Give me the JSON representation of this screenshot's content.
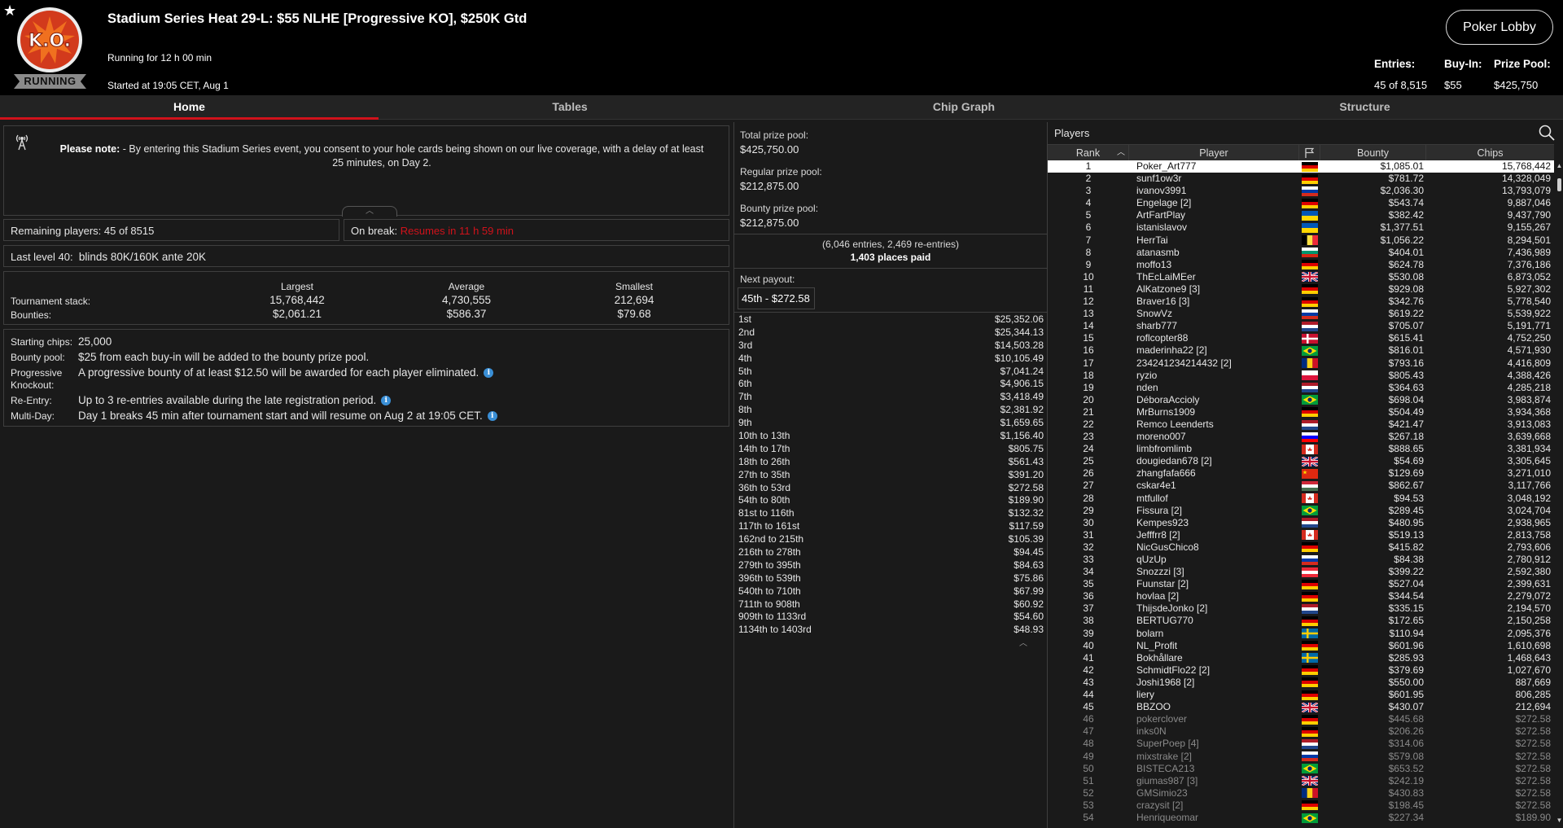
{
  "header": {
    "title": "Stadium Series Heat 29-L: $55 NLHE [Progressive KO], $250K Gtd",
    "logo_text": "K.O.",
    "status": "RUNNING",
    "running_for": "Running for 12 h 00 min",
    "started_at": "Started at 19:05 CET, Aug 1",
    "lobby_button": "Poker Lobby",
    "entries_label": "Entries:",
    "entries_value": "45 of 8,515",
    "buyin_label": "Buy-In:",
    "buyin_value": "$55",
    "prize_label": "Prize Pool:",
    "prize_value": "$425,750"
  },
  "tabs": [
    {
      "label": "Home",
      "active": true
    },
    {
      "label": "Tables",
      "active": false
    },
    {
      "label": "Chip Graph",
      "active": false
    },
    {
      "label": "Structure",
      "active": false
    }
  ],
  "notice": {
    "bold": "Please note:",
    "text": " - By entering this Stadium Series event, you consent to your hole cards being shown on our live coverage, with a delay of at least 25 minutes, on Day 2."
  },
  "remaining": {
    "label": "Remaining players:",
    "value": "45 of 8515"
  },
  "on_break": {
    "label": "On break:",
    "value": "Resumes in 11 h 59 min"
  },
  "last_level": {
    "label": "Last level 40:",
    "value": "blinds 80K/160K ante 20K"
  },
  "stacks": {
    "headers": [
      "Largest",
      "Average",
      "Smallest"
    ],
    "rows": [
      {
        "label": "Tournament stack:",
        "values": [
          "15,768,442",
          "4,730,555",
          "212,694"
        ]
      },
      {
        "label": "Bounties:",
        "values": [
          "$2,061.21",
          "$586.37",
          "$79.68"
        ]
      }
    ]
  },
  "details": {
    "starting_chips": {
      "label": "Starting chips:",
      "value": "25,000"
    },
    "bounty_pool": {
      "label": "Bounty pool:",
      "value": "$25 from each buy-in will be added to the bounty prize pool."
    },
    "progressive": {
      "label1": "Progressive",
      "label2": "Knockout:",
      "value": "A progressive bounty of at least $12.50 will be awarded for each player eliminated."
    },
    "reentry": {
      "label": "Re-Entry:",
      "value": "Up to 3 re-entries available during the late registration period."
    },
    "multiday": {
      "label": "Multi-Day:",
      "value": "Day 1 breaks 45 min after tournament start and will resume on Aug 2 at 19:05 CET."
    },
    "info_glyph": "i"
  },
  "prize_pools": {
    "total_label": "Total prize pool:",
    "total_value": "$425,750.00",
    "regular_label": "Regular prize pool:",
    "regular_value": "$212,875.00",
    "bounty_label": "Bounty prize pool:",
    "bounty_value": "$212,875.00",
    "entries_note": "(6,046 entries, 2,469 re-entries)",
    "places_paid": "1,403 places paid",
    "next_payout_label": "Next payout:",
    "next_payout_value": "45th - $272.58"
  },
  "payouts": [
    {
      "place": "1st",
      "amount": "$25,352.06"
    },
    {
      "place": "2nd",
      "amount": "$25,344.13"
    },
    {
      "place": "3rd",
      "amount": "$14,503.28"
    },
    {
      "place": "4th",
      "amount": "$10,105.49"
    },
    {
      "place": "5th",
      "amount": "$7,041.24"
    },
    {
      "place": "6th",
      "amount": "$4,906.15"
    },
    {
      "place": "7th",
      "amount": "$3,418.49"
    },
    {
      "place": "8th",
      "amount": "$2,381.92"
    },
    {
      "place": "9th",
      "amount": "$1,659.65"
    },
    {
      "place": "10th to 13th",
      "amount": "$1,156.40"
    },
    {
      "place": "14th to 17th",
      "amount": "$805.75"
    },
    {
      "place": "18th to 26th",
      "amount": "$561.43"
    },
    {
      "place": "27th to 35th",
      "amount": "$391.20"
    },
    {
      "place": "36th to 53rd",
      "amount": "$272.58"
    },
    {
      "place": "54th to 80th",
      "amount": "$189.90"
    },
    {
      "place": "81st to 116th",
      "amount": "$132.32"
    },
    {
      "place": "117th to 161st",
      "amount": "$117.59"
    },
    {
      "place": "162nd to 215th",
      "amount": "$105.39"
    },
    {
      "place": "216th to 278th",
      "amount": "$94.45"
    },
    {
      "place": "279th to 395th",
      "amount": "$84.63"
    },
    {
      "place": "396th to 539th",
      "amount": "$75.86"
    },
    {
      "place": "540th to 710th",
      "amount": "$67.99"
    },
    {
      "place": "711th to 908th",
      "amount": "$60.92"
    },
    {
      "place": "909th to 1133rd",
      "amount": "$54.60"
    },
    {
      "place": "1134th to 1403rd",
      "amount": "$48.93"
    }
  ],
  "players": {
    "title": "Players",
    "columns": {
      "rank": "Rank",
      "player": "Player",
      "bounty": "Bounty",
      "chips": "Chips"
    },
    "rows": [
      {
        "rank": "1",
        "name": "Poker_Art777",
        "flag": "de",
        "bounty": "$1,085.01",
        "chips": "15,768,442"
      },
      {
        "rank": "2",
        "name": "sunf1ow3r",
        "flag": "de",
        "bounty": "$781.72",
        "chips": "14,328,049"
      },
      {
        "rank": "3",
        "name": "ivanov3991",
        "flag": "ru",
        "bounty": "$2,036.30",
        "chips": "13,793,079"
      },
      {
        "rank": "4",
        "name": "Engelage [2]",
        "flag": "de",
        "bounty": "$543.74",
        "chips": "9,887,046"
      },
      {
        "rank": "5",
        "name": "ArtFartPlay",
        "flag": "ua",
        "bounty": "$382.42",
        "chips": "9,437,790"
      },
      {
        "rank": "6",
        "name": "istanislavov",
        "flag": "ua",
        "bounty": "$1,377.51",
        "chips": "9,155,267"
      },
      {
        "rank": "7",
        "name": "HerrTai",
        "flag": "be",
        "bounty": "$1,056.22",
        "chips": "8,294,501"
      },
      {
        "rank": "8",
        "name": "atanasmb",
        "flag": "bg",
        "bounty": "$404.01",
        "chips": "7,436,989"
      },
      {
        "rank": "9",
        "name": "moffo13",
        "flag": "de",
        "bounty": "$624.78",
        "chips": "7,376,186"
      },
      {
        "rank": "10",
        "name": "ThEcLaiMEer",
        "flag": "gb",
        "bounty": "$530.08",
        "chips": "6,873,052"
      },
      {
        "rank": "11",
        "name": "AlKatzone9 [3]",
        "flag": "de",
        "bounty": "$929.08",
        "chips": "5,927,302"
      },
      {
        "rank": "12",
        "name": "Braver16 [3]",
        "flag": "de",
        "bounty": "$342.76",
        "chips": "5,778,540"
      },
      {
        "rank": "13",
        "name": "SnowVz",
        "flag": "ru",
        "bounty": "$619.22",
        "chips": "5,539,922"
      },
      {
        "rank": "14",
        "name": "sharb777",
        "flag": "nl",
        "bounty": "$705.07",
        "chips": "5,191,771"
      },
      {
        "rank": "15",
        "name": "roflcopter88",
        "flag": "dk",
        "bounty": "$615.41",
        "chips": "4,752,250"
      },
      {
        "rank": "16",
        "name": "maderinha22 [2]",
        "flag": "br",
        "bounty": "$816.01",
        "chips": "4,571,930"
      },
      {
        "rank": "17",
        "name": "234241234214432 [2]",
        "flag": "ro",
        "bounty": "$793.16",
        "chips": "4,416,809"
      },
      {
        "rank": "18",
        "name": "ryzio",
        "flag": "pl",
        "bounty": "$805.43",
        "chips": "4,388,426"
      },
      {
        "rank": "19",
        "name": "nden",
        "flag": "nl",
        "bounty": "$364.63",
        "chips": "4,285,218"
      },
      {
        "rank": "20",
        "name": "DéboraAccioly",
        "flag": "br",
        "bounty": "$698.04",
        "chips": "3,983,874"
      },
      {
        "rank": "21",
        "name": "MrBurns1909",
        "flag": "de",
        "bounty": "$504.49",
        "chips": "3,934,368"
      },
      {
        "rank": "22",
        "name": "Remco Leenderts",
        "flag": "nl",
        "bounty": "$421.47",
        "chips": "3,913,083"
      },
      {
        "rank": "23",
        "name": "moreno007",
        "flag": "si",
        "bounty": "$267.18",
        "chips": "3,639,668"
      },
      {
        "rank": "24",
        "name": "limbfromlimb",
        "flag": "ca",
        "bounty": "$888.65",
        "chips": "3,381,934"
      },
      {
        "rank": "25",
        "name": "dougiedan678 [2]",
        "flag": "gb",
        "bounty": "$54.69",
        "chips": "3,305,645"
      },
      {
        "rank": "26",
        "name": "zhangfafa666",
        "flag": "cn",
        "bounty": "$129.69",
        "chips": "3,271,010"
      },
      {
        "rank": "27",
        "name": "cskar4e1",
        "flag": "hu",
        "bounty": "$862.67",
        "chips": "3,117,766"
      },
      {
        "rank": "28",
        "name": "mtfullof",
        "flag": "ca",
        "bounty": "$94.53",
        "chips": "3,048,192"
      },
      {
        "rank": "29",
        "name": "Fissura [2]",
        "flag": "br",
        "bounty": "$289.45",
        "chips": "3,024,704"
      },
      {
        "rank": "30",
        "name": "Kempes923",
        "flag": "nl",
        "bounty": "$480.95",
        "chips": "2,938,965"
      },
      {
        "rank": "31",
        "name": "Jefffrr8 [2]",
        "flag": "ca",
        "bounty": "$519.13",
        "chips": "2,813,758"
      },
      {
        "rank": "32",
        "name": "NicGusChico8",
        "flag": "de",
        "bounty": "$415.82",
        "chips": "2,793,606"
      },
      {
        "rank": "33",
        "name": "qUzUp",
        "flag": "ru",
        "bounty": "$84.38",
        "chips": "2,780,912"
      },
      {
        "rank": "34",
        "name": "Snozzzi [3]",
        "flag": "at",
        "bounty": "$399.22",
        "chips": "2,592,380"
      },
      {
        "rank": "35",
        "name": "Fuunstar [2]",
        "flag": "de",
        "bounty": "$527.04",
        "chips": "2,399,631"
      },
      {
        "rank": "36",
        "name": "hovlaa [2]",
        "flag": "de",
        "bounty": "$344.54",
        "chips": "2,279,072"
      },
      {
        "rank": "37",
        "name": "ThijsdeJonko [2]",
        "flag": "nl",
        "bounty": "$335.15",
        "chips": "2,194,570"
      },
      {
        "rank": "38",
        "name": "BERTUG770",
        "flag": "de",
        "bounty": "$172.65",
        "chips": "2,150,258"
      },
      {
        "rank": "39",
        "name": "bolarn",
        "flag": "se",
        "bounty": "$110.94",
        "chips": "2,095,376"
      },
      {
        "rank": "40",
        "name": "NL_Profit",
        "flag": "de",
        "bounty": "$601.96",
        "chips": "1,610,698"
      },
      {
        "rank": "41",
        "name": "Bokhållare",
        "flag": "se",
        "bounty": "$285.93",
        "chips": "1,468,643"
      },
      {
        "rank": "42",
        "name": "SchmidtFlo22 [2]",
        "flag": "de",
        "bounty": "$379.69",
        "chips": "1,027,670"
      },
      {
        "rank": "43",
        "name": "Joshi1968 [2]",
        "flag": "de",
        "bounty": "$550.00",
        "chips": "887,669"
      },
      {
        "rank": "44",
        "name": "liery",
        "flag": "de",
        "bounty": "$601.95",
        "chips": "806,285"
      },
      {
        "rank": "45",
        "name": "BBZOO",
        "flag": "gb",
        "bounty": "$430.07",
        "chips": "212,694"
      },
      {
        "rank": "46",
        "name": "pokerclover",
        "flag": "de",
        "bounty": "$445.68",
        "chips": "$272.58"
      },
      {
        "rank": "47",
        "name": "inks0N",
        "flag": "de",
        "bounty": "$206.26",
        "chips": "$272.58"
      },
      {
        "rank": "48",
        "name": "SuperPoep [4]",
        "flag": "nl",
        "bounty": "$314.06",
        "chips": "$272.58"
      },
      {
        "rank": "49",
        "name": "mixstrake [2]",
        "flag": "ru",
        "bounty": "$579.08",
        "chips": "$272.58"
      },
      {
        "rank": "50",
        "name": "BISTECA213",
        "flag": "br",
        "bounty": "$653.52",
        "chips": "$272.58"
      },
      {
        "rank": "51",
        "name": "giumas987 [3]",
        "flag": "gb",
        "bounty": "$242.19",
        "chips": "$272.58"
      },
      {
        "rank": "52",
        "name": "GMSimio23",
        "flag": "ro",
        "bounty": "$430.83",
        "chips": "$272.58"
      },
      {
        "rank": "53",
        "name": "crazysit [2]",
        "flag": "de",
        "bounty": "$198.45",
        "chips": "$272.58"
      },
      {
        "rank": "54",
        "name": "Henriqueomar",
        "flag": "br",
        "bounty": "$227.34",
        "chips": "$189.90"
      }
    ]
  },
  "colors": {
    "accent": "#d0121b",
    "background": "#1a1a1a",
    "header": "#000000",
    "info": "#3a8fd6"
  }
}
